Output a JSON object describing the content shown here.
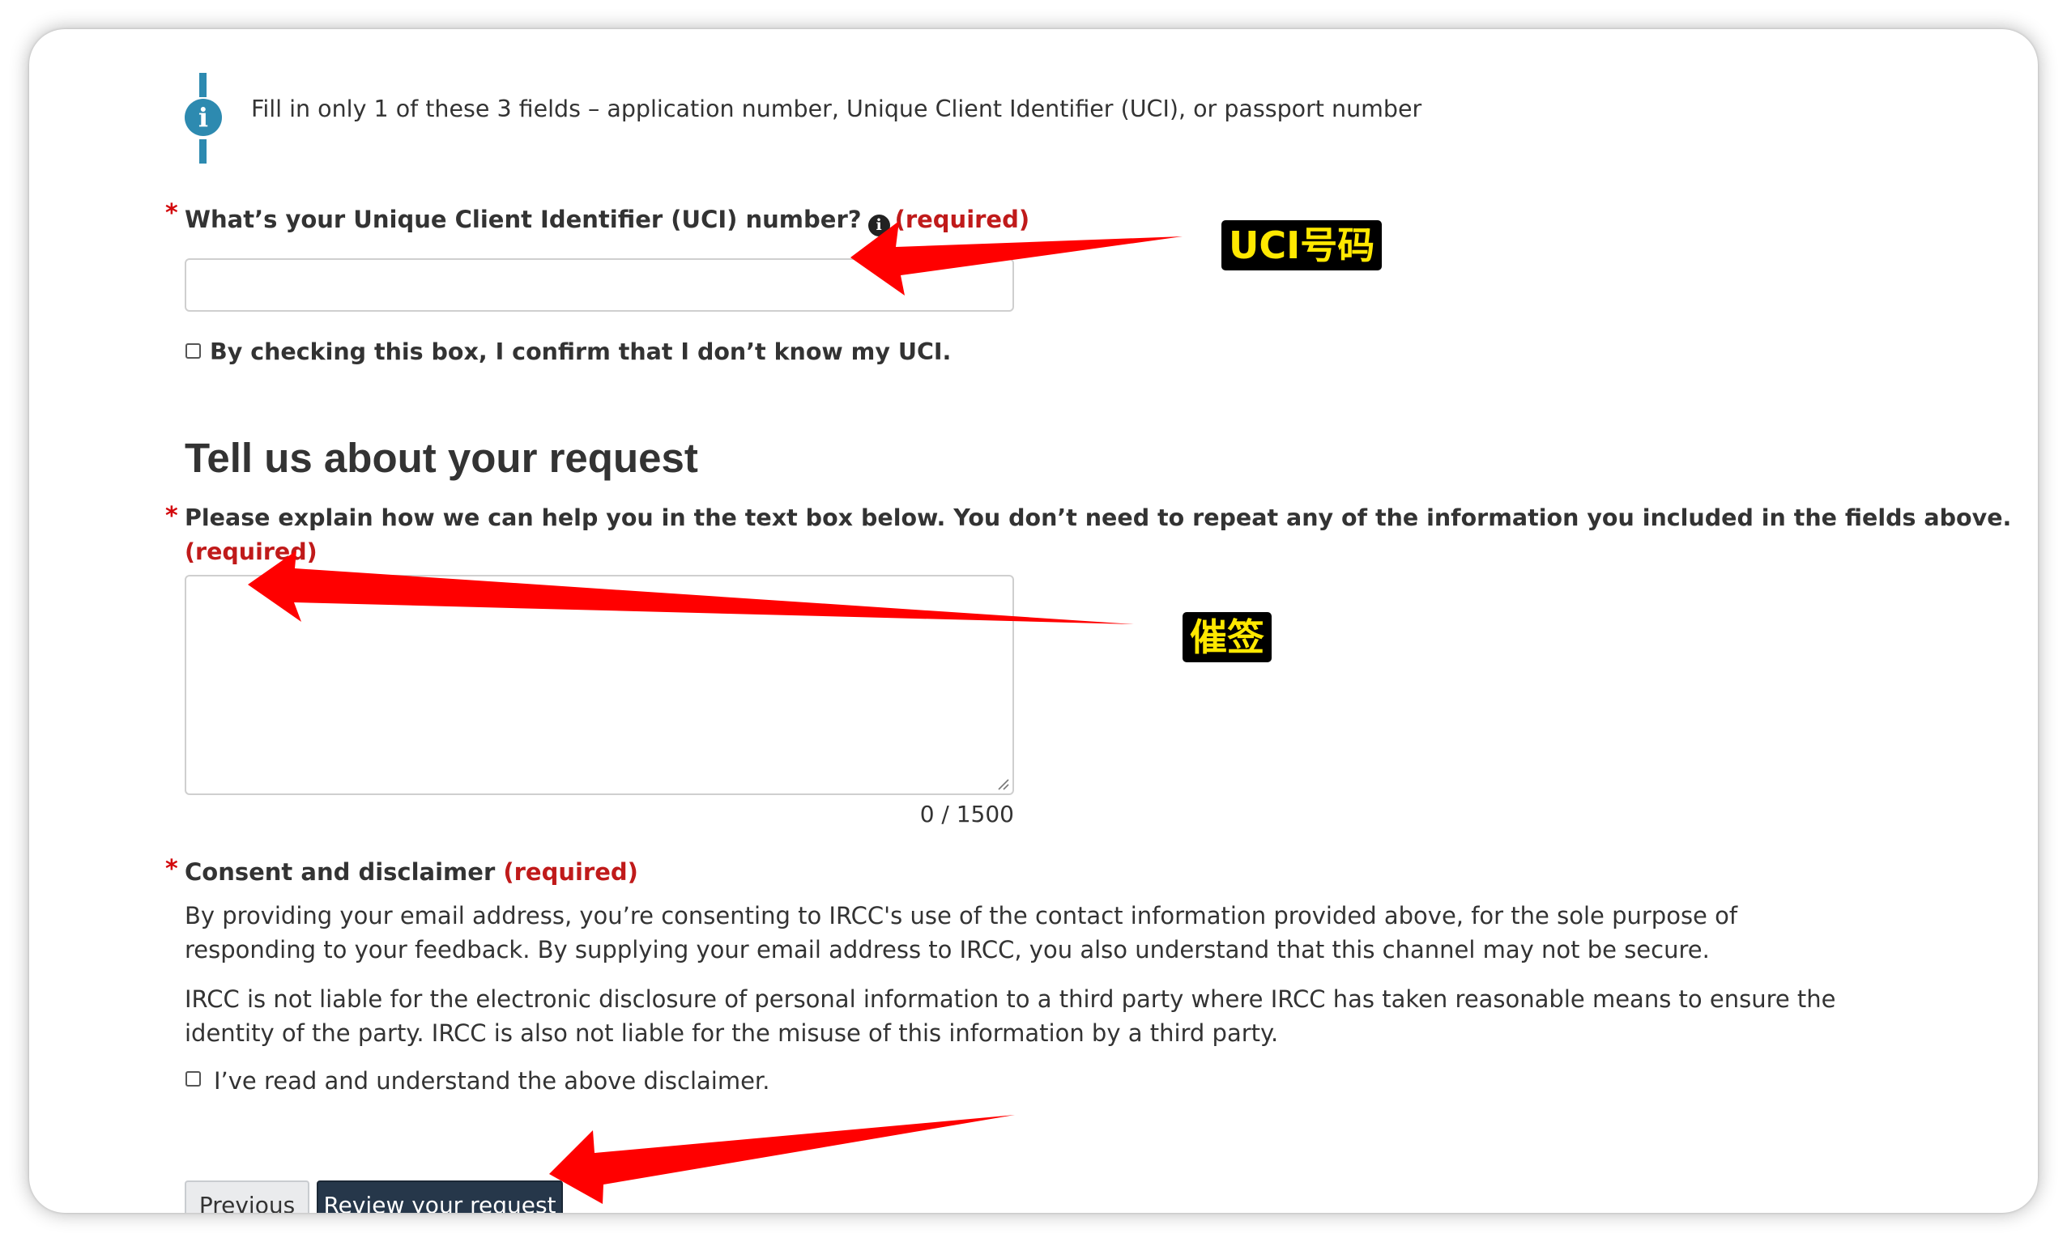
{
  "info_alert": {
    "icon": "info-icon",
    "text": "Fill in only 1 of these 3 fields – application number, Unique Client Identifier (UCI), or passport number"
  },
  "uci_field": {
    "asterisk": "*",
    "label": "What’s your Unique Client Identifier (UCI) number?",
    "help_icon": "info-icon",
    "required": "(required)",
    "value": "",
    "dont_know_checkbox_label": "By checking this box, I confirm that I don’t know my UCI.",
    "dont_know_checked": false
  },
  "request_section": {
    "heading": "Tell us about your request",
    "asterisk": "*",
    "label": "Please explain how we can help you in the text box below. You don’t need to repeat any of the information you included in the fields above.",
    "required": "(required)",
    "value": "",
    "char_count": "0 / 1500"
  },
  "consent": {
    "asterisk": "*",
    "label": "Consent and disclaimer",
    "required": "(required)",
    "paragraph1": "By providing your email address, you’re consenting to IRCC's use of the contact information provided above, for the sole purpose of responding to your feedback. By supplying your email address to IRCC, you also understand that this channel may not be secure.",
    "paragraph2": "IRCC is not liable for the electronic disclosure of personal information to a third party where IRCC has taken reasonable means to ensure the identity of the party. IRCC is also not liable for the misuse of this information by a third party.",
    "checkbox_label": "I’ve read and understand the above disclaimer.",
    "checked": false
  },
  "buttons": {
    "previous": "Previous",
    "review": "Review your request"
  },
  "annotations": {
    "uci_callout": "UCI号码",
    "request_callout": "催签",
    "arrow_color": "#ff0000",
    "callout_text_color": "#ffe800"
  },
  "colors": {
    "primary_button": "#26374a",
    "required_text": "#c01a1a",
    "info_accent": "#2d8ab0"
  }
}
